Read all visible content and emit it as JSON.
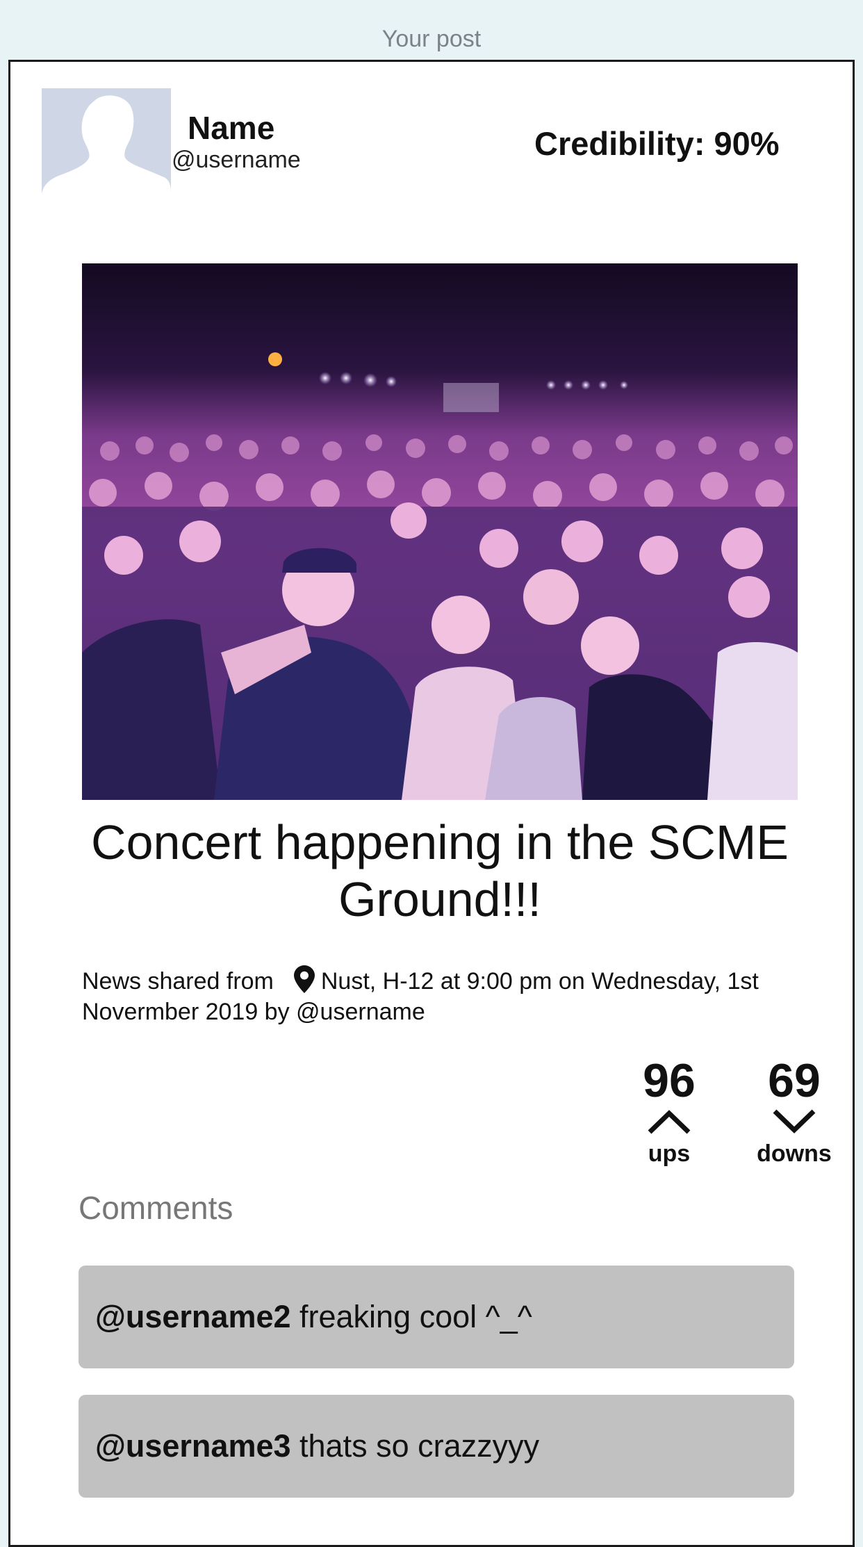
{
  "header": {
    "title": "Your post"
  },
  "author": {
    "name": "Name",
    "handle": "@username",
    "credibility": "Credibility: 90%"
  },
  "post": {
    "title": "Concert happening in the SCME Ground!!!",
    "shared_prefix": "News shared from",
    "location_text": "Nust, H-12 at 9:00 pm on Wednesday, 1st Novermber 2019 by @username"
  },
  "votes": {
    "ups_count": "96",
    "ups_label": "ups",
    "downs_count": "69",
    "downs_label": "downs"
  },
  "comments": {
    "heading": "Comments",
    "items": [
      {
        "user": "@username2",
        "text": " freaking cool ^_^"
      },
      {
        "user": "@username3",
        "text": " thats so crazzyyy"
      }
    ]
  },
  "icons": {
    "location": "map-pin-icon",
    "upvote": "chevron-up-icon",
    "downvote": "chevron-down-icon"
  },
  "colors": {
    "background": "#e8f3f6",
    "avatar_bg": "#cfd6e6",
    "comment_bg": "#c1c1c1"
  }
}
